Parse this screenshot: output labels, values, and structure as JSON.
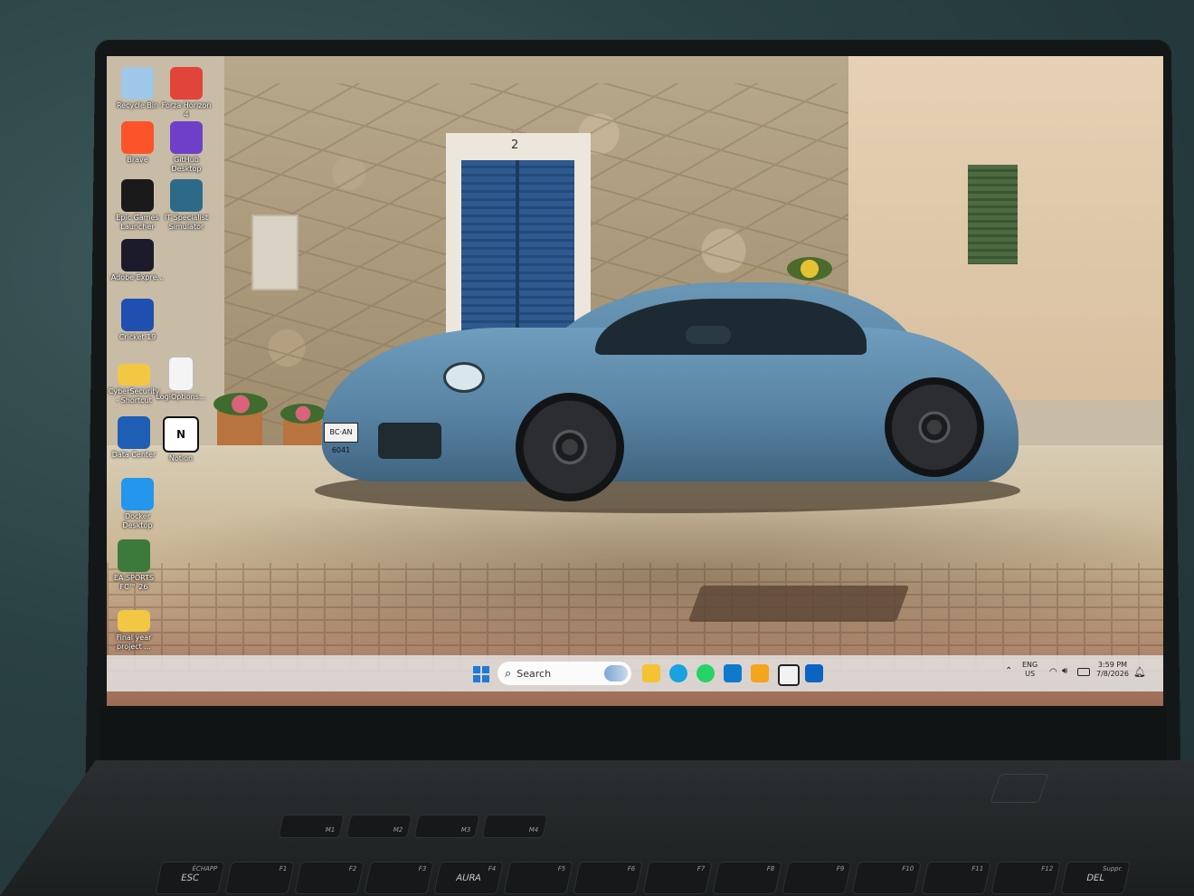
{
  "desktop_icons": [
    {
      "label": "Recycle Bin",
      "icon": "recycle-bin-icon",
      "color": "#9ec7e8"
    },
    {
      "label": "Forza Horizon 4",
      "icon": "forza-icon",
      "color": "#e0443a"
    },
    {
      "label": "Brave",
      "icon": "brave-icon",
      "color": "#fb542b"
    },
    {
      "label": "GitHub Desktop",
      "icon": "github-icon",
      "color": "#6e40c9"
    },
    {
      "label": "Epic Games Launcher",
      "icon": "epic-games-icon",
      "color": "#1a1a1a"
    },
    {
      "label": "IT Specialist Simulator",
      "icon": "it-simulator-icon",
      "color": "#2d6a8a"
    },
    {
      "label": "Adobe Expre...",
      "icon": "adobe-express-icon",
      "color": "#1b1b2b"
    },
    {
      "label": "Cricket 19",
      "icon": "cricket-icon",
      "color": "#1f4fb0"
    },
    {
      "label": "CyberSecurity - Shortcut",
      "icon": "folder-icon",
      "color": "#f2c744"
    },
    {
      "label": "LogiOptions...",
      "icon": "file-icon",
      "color": "#f4f4f4"
    },
    {
      "label": "Data Center",
      "icon": "data-center-icon",
      "color": "#1e5fb5"
    },
    {
      "label": "Notion",
      "icon": "notion-icon",
      "color": "#ffffff"
    },
    {
      "label": "Docker Desktop",
      "icon": "docker-icon",
      "color": "#2496ed"
    },
    {
      "label": "EA SPORTS FC™ 26",
      "icon": "ea-fc-icon",
      "color": "#3b7a3b"
    },
    {
      "label": "Final year project ...",
      "icon": "folder-icon",
      "color": "#f2c744"
    }
  ],
  "wallpaper": {
    "door_number": "2",
    "plate_text": "BC·AN 6041"
  },
  "taskbar": {
    "search_label": "Search",
    "apps": [
      {
        "name": "file-explorer-icon",
        "color": "#f4c232"
      },
      {
        "name": "edge-icon",
        "color": "#1aa1e0"
      },
      {
        "name": "whatsapp-icon",
        "color": "#25d366"
      },
      {
        "name": "vscode-icon",
        "color": "#0e7acc"
      },
      {
        "name": "virtualbox-icon",
        "color": "#f3a51b"
      },
      {
        "name": "notion-icon",
        "color": "#f2f2f2"
      },
      {
        "name": "outlook-icon",
        "color": "#0a64c2"
      }
    ],
    "lang_top": "ENG",
    "lang_bottom": "US",
    "time": "3:59 PM",
    "date": "7/8/2026"
  },
  "keyboard": {
    "top_row": [
      "M1",
      "M2",
      "M3",
      "M4"
    ],
    "fn_row": [
      {
        "main": "ESC",
        "sub": "ÉCHAPP"
      },
      {
        "main": "",
        "sub": "F1"
      },
      {
        "main": "",
        "sub": "F2"
      },
      {
        "main": "",
        "sub": "F3"
      },
      {
        "main": "AURA",
        "sub": "F4"
      },
      {
        "main": "",
        "sub": "F5"
      },
      {
        "main": "",
        "sub": "F6"
      },
      {
        "main": "",
        "sub": "F7"
      },
      {
        "main": "",
        "sub": "F8"
      },
      {
        "main": "",
        "sub": "F9"
      },
      {
        "main": "",
        "sub": "F10"
      },
      {
        "main": "",
        "sub": "F11"
      },
      {
        "main": "",
        "sub": "F12"
      },
      {
        "main": "DEL",
        "sub": "Suppr."
      }
    ]
  }
}
